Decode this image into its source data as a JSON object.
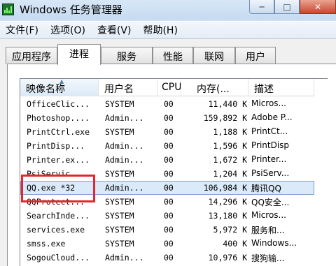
{
  "window": {
    "title": "Windows 任务管理器",
    "minimize_icon": "minimize-icon",
    "maximize_icon": "maximize-icon",
    "close_icon": "close-icon"
  },
  "menu": [
    "文件(F)",
    "选项(O)",
    "查看(V)",
    "帮助(H)"
  ],
  "tabs": [
    "应用程序",
    "进程",
    "服务",
    "性能",
    "联网",
    "用户"
  ],
  "active_tab": "进程",
  "columns": [
    "映像名称",
    "用户名",
    "CPU",
    "内存(...",
    "描述"
  ],
  "processes": [
    {
      "name": "OfficeClic...",
      "user": "SYSTEM",
      "cpu": "00",
      "mem": "11,440 K",
      "desc": "Micros..."
    },
    {
      "name": "Photoshop....",
      "user": "Admin...",
      "cpu": "00",
      "mem": "159,892 K",
      "desc": "Adobe P..."
    },
    {
      "name": "PrintCtrl.exe",
      "user": "SYSTEM",
      "cpu": "00",
      "mem": "1,188 K",
      "desc": "PrintCt..."
    },
    {
      "name": "PrintDisp...",
      "user": "Admin...",
      "cpu": "00",
      "mem": "1,596 K",
      "desc": "PrintDisp"
    },
    {
      "name": "Printer.ex...",
      "user": "Admin...",
      "cpu": "00",
      "mem": "1,672 K",
      "desc": "Printer..."
    },
    {
      "name": "PsiServic...",
      "user": "SYSTEM",
      "cpu": "00",
      "mem": "1,204 K",
      "desc": "PsiServ..."
    },
    {
      "name": "QQ.exe *32",
      "user": "Admin...",
      "cpu": "00",
      "mem": "106,984 K",
      "desc": "腾讯QQ"
    },
    {
      "name": "QQProtect...",
      "user": "SYSTEM",
      "cpu": "00",
      "mem": "14,296 K",
      "desc": "QQ安全..."
    },
    {
      "name": "SearchInde...",
      "user": "SYSTEM",
      "cpu": "00",
      "mem": "13,180 K",
      "desc": "Micros..."
    },
    {
      "name": "services.exe",
      "user": "SYSTEM",
      "cpu": "00",
      "mem": "5,972 K",
      "desc": "服务和..."
    },
    {
      "name": "smss.exe",
      "user": "SYSTEM",
      "cpu": "00",
      "mem": "400 K",
      "desc": "Windows..."
    },
    {
      "name": "SogouCloud...",
      "user": "Admin...",
      "cpu": "00",
      "mem": "10,976 K",
      "desc": "搜狗输..."
    }
  ],
  "selected_process": "QQ.exe *32",
  "highlight_color": "#e0282f",
  "selection_color": "#dbeaf8"
}
